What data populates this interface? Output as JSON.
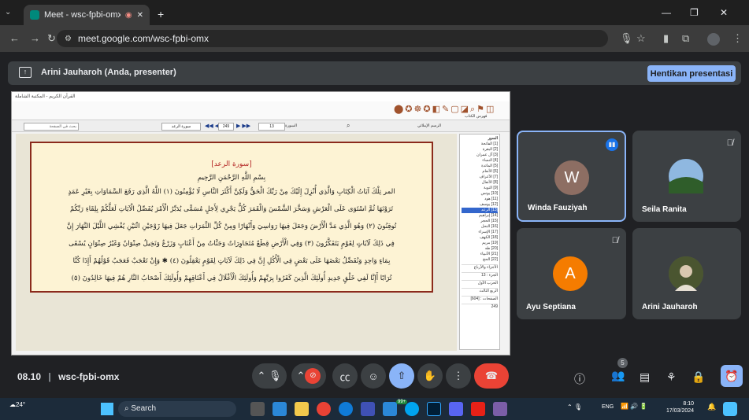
{
  "browser": {
    "tab_title": "Meet - wsc-fpbi-omx",
    "url": "meet.google.com/wsc-fpbi-omx",
    "new_tab": "+",
    "win_minimize": "—",
    "win_restore": "❐",
    "win_close": "✕"
  },
  "presenting": {
    "label": "Arini Jauharoh (Anda, presenter)",
    "stop_button": "Hentikan presentasi"
  },
  "shared_screen": {
    "window_title": "القرآن الكريم - المكتبة الشاملة",
    "search_placeholder": "بحث في الصفحة",
    "surah_field": "سورة الرعد",
    "page_field": "249",
    "surah_number": "13",
    "surah_label": "السورة",
    "mushaf_label": "الرسم الإملائي",
    "sidebar_label": "فهرس الكتاب",
    "sidebar_tab": "السور",
    "sidebar_items": [
      "[1] الفاتحة",
      "[2] البقرة",
      "[3] آل عمران",
      "[4] النساء",
      "[5] المائدة",
      "[6] الأنعام",
      "[7] الأعراف",
      "[8] الأنفال",
      "[9] التوبة",
      "[10] يونس",
      "[11] هود",
      "[12] يوسف",
      "[13] الرعد",
      "[14] إبراهيم",
      "[15] الحجر",
      "[16] النحل",
      "[17] الإسراء",
      "[18] الكهف",
      "[19] مريم",
      "[20] طه",
      "[21] الأنبياء",
      "[22] الحج"
    ],
    "sidebar_bottom": [
      "الأجزاء والأرباع",
      "الجزء : 13",
      "الحزب الأول",
      "الربع الثالث",
      "الصفحات : [604]",
      "249"
    ],
    "quran_text": {
      "surah_title": "[سورة الرعد]",
      "basmala": "بِسْمِ اللَّهِ الرَّحْمَنِ الرَّحِيمِ",
      "lines": [
        "المر تِلْكَ آيَاتُ الْكِتَابِ وَالَّذِي أُنْزِلَ إِلَيْكَ مِنْ رَبِّكَ الْحَقُّ وَلَكِنَّ أَكْثَرَ النَّاسِ لَا يُؤْمِنُونَ (١) اللَّهُ الَّذِي رَفَعَ السَّمَاوَاتِ بِغَيْرِ عَمَدٍ",
        "تَرَوْنَهَا ثُمَّ اسْتَوَى عَلَى الْعَرْشِ وَسَخَّرَ الشَّمْسَ وَالْقَمَرَ كُلٌّ يَجْرِي لِأَجَلٍ مُسَمًّى يُدَبِّرُ الْأَمْرَ يُفَصِّلُ الْآيَاتِ لَعَلَّكُمْ بِلِقَاءِ رَبِّكُمْ",
        "تُوقِنُونَ (٢) وَهُوَ الَّذِي مَدَّ الْأَرْضَ وَجَعَلَ فِيهَا رَوَاسِيَ وَأَنْهَارًا وَمِنْ كُلِّ الثَّمَرَاتِ جَعَلَ فِيهَا زَوْجَيْنِ اثْنَيْنِ يُغْشِي اللَّيْلَ النَّهَارَ إِنَّ",
        "فِي ذَلِكَ لَآيَاتٍ لِقَوْمٍ يَتَفَكَّرُونَ (٣) وَفِي الْأَرْضِ قِطَعٌ مُتَجَاوِرَاتٌ وَجَنَّاتٌ مِنْ أَعْنَابٍ وَزَرْعٌ وَنَخِيلٌ صِنْوَانٌ وَغَيْرُ صِنْوَانٍ يُسْقَى",
        "بِمَاءٍ وَاحِدٍ وَنُفَضِّلُ بَعْضَهَا عَلَى بَعْضٍ فِي الْأُكُلِ إِنَّ فِي ذَلِكَ لَآيَاتٍ لِقَوْمٍ يَعْقِلُونَ (٤) ✱ وَإِنْ تَعْجَبْ فَعَجَبٌ قَوْلُهُمْ أَإِذَا كُنَّا",
        "تُرَابًا أَإِنَّا لَفِي خَلْقٍ جَدِيدٍ أُولَئِكَ الَّذِينَ كَفَرُوا بِرَبِّهِمْ وَأُولَئِكَ الْأَغْلَالُ فِي أَعْنَاقِهِمْ وَأُولَئِكَ أَصْحَابُ النَّارِ هُمْ فِيهَا خَالِدُونَ (٥)"
      ]
    }
  },
  "participants": [
    {
      "name": "Winda Fauziyah",
      "initial": "W",
      "color": "#8d6e63",
      "speaking": true
    },
    {
      "name": "Seila Ranita",
      "initial": "",
      "color": "#3a6ea5",
      "muted": true
    },
    {
      "name": "Ayu Septiana",
      "initial": "A",
      "color": "#f57c00",
      "muted": true
    },
    {
      "name": "Arini Jauharoh",
      "initial": "",
      "color": "#5d6b3a"
    }
  ],
  "meeting": {
    "time": "08.10",
    "separator": "|",
    "code": "wsc-fpbi-omx",
    "participant_count": "5"
  },
  "taskbar": {
    "weather": "24°",
    "search": "Search",
    "lang": "ENG",
    "clock_time": "8:10",
    "clock_date": "17/03/2024",
    "badge": "99+"
  },
  "colors": {
    "accent": "#8ab4f8",
    "end_call": "#ea4335",
    "speaking_border": "#8ab4f8"
  }
}
